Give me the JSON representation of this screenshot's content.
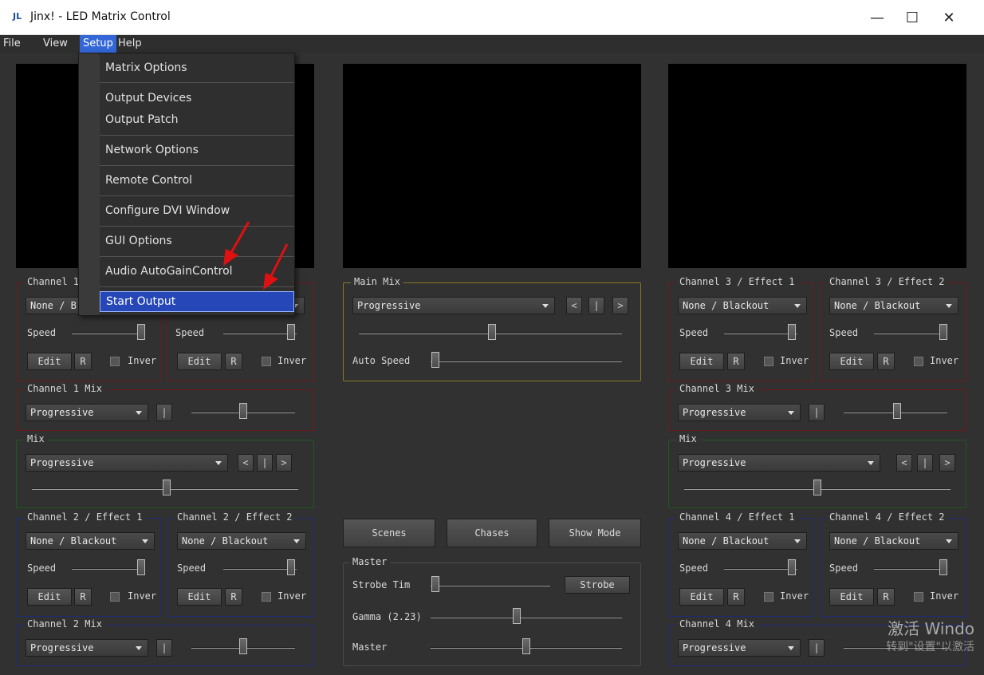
{
  "window": {
    "title": "Jinx! - LED Matrix Control",
    "logo": "JL"
  },
  "menubar": [
    "File",
    "View",
    "Setup",
    "Help"
  ],
  "setup_menu": {
    "items": [
      "Matrix Options",
      "Output Devices",
      "Output Patch",
      "Network Options",
      "Remote Control",
      "Configure DVI Window",
      "GUI Options",
      "Audio AutoGainControl",
      "Start Output"
    ],
    "highlighted": "Start Output"
  },
  "labels": {
    "speed": "Speed",
    "edit": "Edit",
    "r": "R",
    "invert": "Inver",
    "auto_speed": "Auto Speed",
    "blackout": "None / Blackout",
    "blackout_short": "None / B",
    "progressive": "Progressive",
    "prev": "<",
    "pause": "|",
    "next": ">"
  },
  "groups": {
    "ch1_fx1": "Channel 1",
    "ch1_mix": "Channel 1 Mix",
    "mix_left": "Mix",
    "ch2_fx1": "Channel 2 / Effect 1",
    "ch2_fx2": "Channel 2 / Effect 2",
    "ch2_mix": "Channel 2 Mix",
    "main_mix": "Main Mix",
    "ch3_fx1": "Channel 3 / Effect 1",
    "ch3_fx2": "Channel 3 / Effect 2",
    "ch3_mix": "Channel 3 Mix",
    "mix_right": "Mix",
    "ch4_fx1": "Channel 4 / Effect 1",
    "ch4_fx2": "Channel 4 / Effect 2",
    "ch4_mix": "Channel 4 Mix",
    "master": "Master"
  },
  "buttons": {
    "scenes": "Scenes",
    "chases": "Chases",
    "show_mode": "Show Mode",
    "strobe": "Strobe"
  },
  "master": {
    "strobe_time": "Strobe Tim",
    "gamma": "Gamma (2.23)",
    "master": "Master"
  },
  "watermark": {
    "line1": "激活 Windo",
    "line2": "转到\"设置\"以激活"
  },
  "colors": {
    "accent": "#3366d6",
    "group_red": "#6d1a1a",
    "group_blue": "#1e2b7a",
    "group_green": "#1d5a1d",
    "group_yellow": "#8a7a22",
    "annotation": "#e01010"
  }
}
